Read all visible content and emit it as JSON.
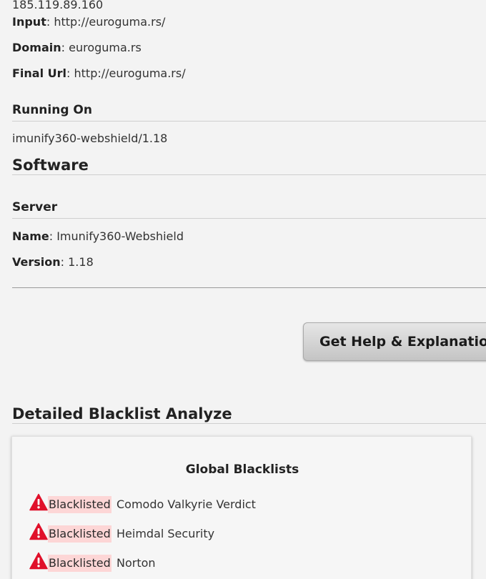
{
  "ip": "185.119.89.160",
  "info": {
    "input_label": "Input",
    "input_value": "http://euroguma.rs/",
    "domain_label": "Domain",
    "domain_value": "euroguma.rs",
    "final_url_label": "Final Url",
    "final_url_value": "http://euroguma.rs/"
  },
  "running_on": {
    "heading": "Running On",
    "value": "imunify360-webshield/1.18"
  },
  "software": {
    "heading": "Software",
    "server_heading": "Server",
    "name_label": "Name",
    "name_value": "Imunify360-Webshield",
    "version_label": "Version",
    "version_value": "1.18"
  },
  "help_button": {
    "label": "Get Help & Explanation"
  },
  "blacklist": {
    "heading": "Detailed Blacklist Analyze",
    "card_title": "Global Blacklists",
    "status_label": "Blacklisted",
    "entries": [
      {
        "status": "Blacklisted",
        "name": "Comodo Valkyrie Verdict"
      },
      {
        "status": "Blacklisted",
        "name": "Heimdal Security"
      },
      {
        "status": "Blacklisted",
        "name": "Norton"
      }
    ]
  },
  "colors": {
    "background": "#f3f3f3",
    "warning_red": "#e0102a",
    "badge_bg": "#fdd6d6"
  },
  "icons": {
    "warning": "warning-triangle-icon"
  }
}
